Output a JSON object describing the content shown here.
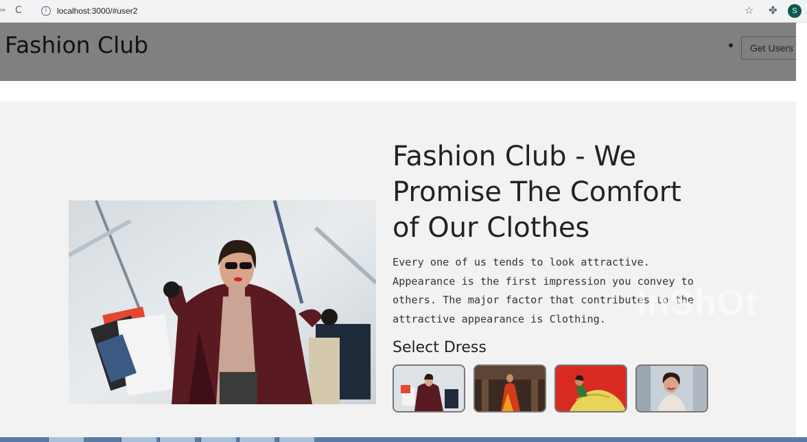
{
  "browser": {
    "url": "localhost:3000/#user2",
    "back_icon": "back-arrow-icon",
    "reload_icon": "reload-icon",
    "profile_initial": "S"
  },
  "header": {
    "brand": "Fashion Club",
    "get_users_label": "Get Users"
  },
  "hero": {
    "headline": "Fashion Club - We Promise The Comfort of Our Clothes",
    "description": "Every one of us tends to look attractive. Appearance is the first impression you convey to others. The major factor that contributes to the attractive appearance is Clothing.",
    "select_title": "Select Dress",
    "thumbnails": [
      "dress-1",
      "dress-2",
      "dress-3",
      "dress-4"
    ]
  },
  "watermark": "InShOt",
  "colors": {
    "header_bg": "#808080",
    "hero_bg": "#f2f2f2",
    "text_dark": "#222222"
  }
}
